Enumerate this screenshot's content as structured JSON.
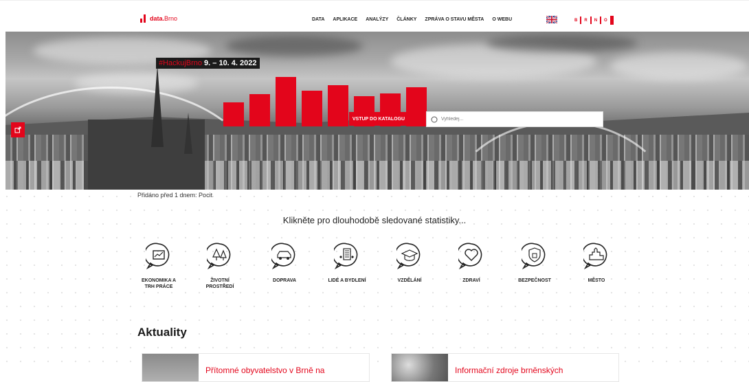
{
  "header": {
    "logo": {
      "brand": "data.",
      "city": "Brno"
    },
    "nav": [
      "DATA",
      "APLIKACE",
      "ANALÝZY",
      "ČLÁNKY",
      "ZPRÁVA O STAVU MĚSTA",
      "O WEBU"
    ],
    "language_icon": "uk-flag-icon",
    "brno_logo_letters": [
      "B",
      "R",
      "N",
      "O"
    ]
  },
  "hero": {
    "hashtag": "#HackujBrno",
    "dates": "9. – 10. 4. 2022",
    "catalog_button": "VSTUP DO KATALOGU",
    "search_placeholder": "Vyhledej...",
    "share_icon": "share-icon",
    "bar_levels": [
      0.35,
      0.47,
      0.72,
      0.52,
      0.6,
      0.44,
      0.48,
      0.57
    ]
  },
  "added_note": "Přidáno před 1 dnem: Pocit",
  "stats_heading": "Klikněte pro dlouhodobě sledované statistiky...",
  "categories": [
    {
      "label": "EKONOMIKA A TRH PRÁCE",
      "icon": "economy-chart-icon"
    },
    {
      "label": "ŽIVOTNÍ PROSTŘEDÍ",
      "icon": "trees-icon"
    },
    {
      "label": "DOPRAVA",
      "icon": "car-icon"
    },
    {
      "label": "LIDÉ A BYDLENÍ",
      "icon": "buildings-people-icon"
    },
    {
      "label": "VZDĚLÁNÍ",
      "icon": "graduation-cap-icon"
    },
    {
      "label": "ZDRAVÍ",
      "icon": "heart-icon"
    },
    {
      "label": "BEZPEČNOST",
      "icon": "shield-lock-icon"
    },
    {
      "label": "MĚSTO",
      "icon": "city-icon"
    }
  ],
  "news": {
    "heading": "Aktuality",
    "cards": [
      {
        "title": "Přítomné obyvatelstvo v Brně na"
      },
      {
        "title": "Informační zdroje brněnských"
      }
    ]
  },
  "colors": {
    "accent": "#e3051b",
    "text": "#222222"
  }
}
